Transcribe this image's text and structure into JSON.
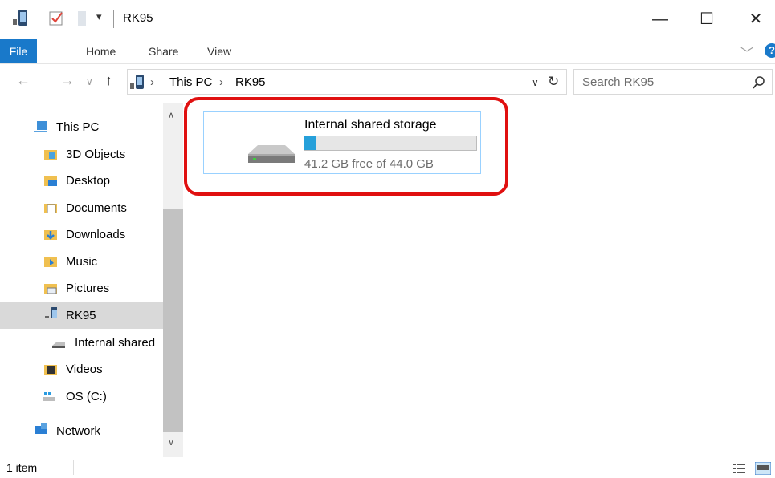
{
  "window": {
    "title": "RK95"
  },
  "ribbon": {
    "file": "File",
    "home": "Home",
    "share": "Share",
    "view": "View"
  },
  "address": {
    "segments": [
      "This PC",
      "RK95"
    ]
  },
  "search": {
    "placeholder": "Search RK95"
  },
  "nav": {
    "items": [
      {
        "label": "This PC",
        "icon": "computer-icon"
      },
      {
        "label": "3D Objects",
        "icon": "3d-objects-icon"
      },
      {
        "label": "Desktop",
        "icon": "desktop-folder-icon"
      },
      {
        "label": "Documents",
        "icon": "documents-folder-icon"
      },
      {
        "label": "Downloads",
        "icon": "downloads-folder-icon"
      },
      {
        "label": "Music",
        "icon": "music-folder-icon"
      },
      {
        "label": "Pictures",
        "icon": "pictures-folder-icon"
      },
      {
        "label": "RK95",
        "icon": "device-icon",
        "selected": true
      },
      {
        "label": "Internal shared",
        "icon": "drive-icon"
      },
      {
        "label": "Videos",
        "icon": "videos-folder-icon"
      },
      {
        "label": "OS (C:)",
        "icon": "windows-drive-icon"
      },
      {
        "label": "Network",
        "icon": "network-icon"
      }
    ]
  },
  "drive": {
    "name": "Internal shared storage",
    "free_text": "41.2 GB free of 44.0 GB",
    "used_fraction": 0.064
  },
  "status": {
    "count": "1 item"
  },
  "colors": {
    "accent": "#1979ca",
    "highlight": "#e01010",
    "bar_fill": "#26a0da"
  }
}
